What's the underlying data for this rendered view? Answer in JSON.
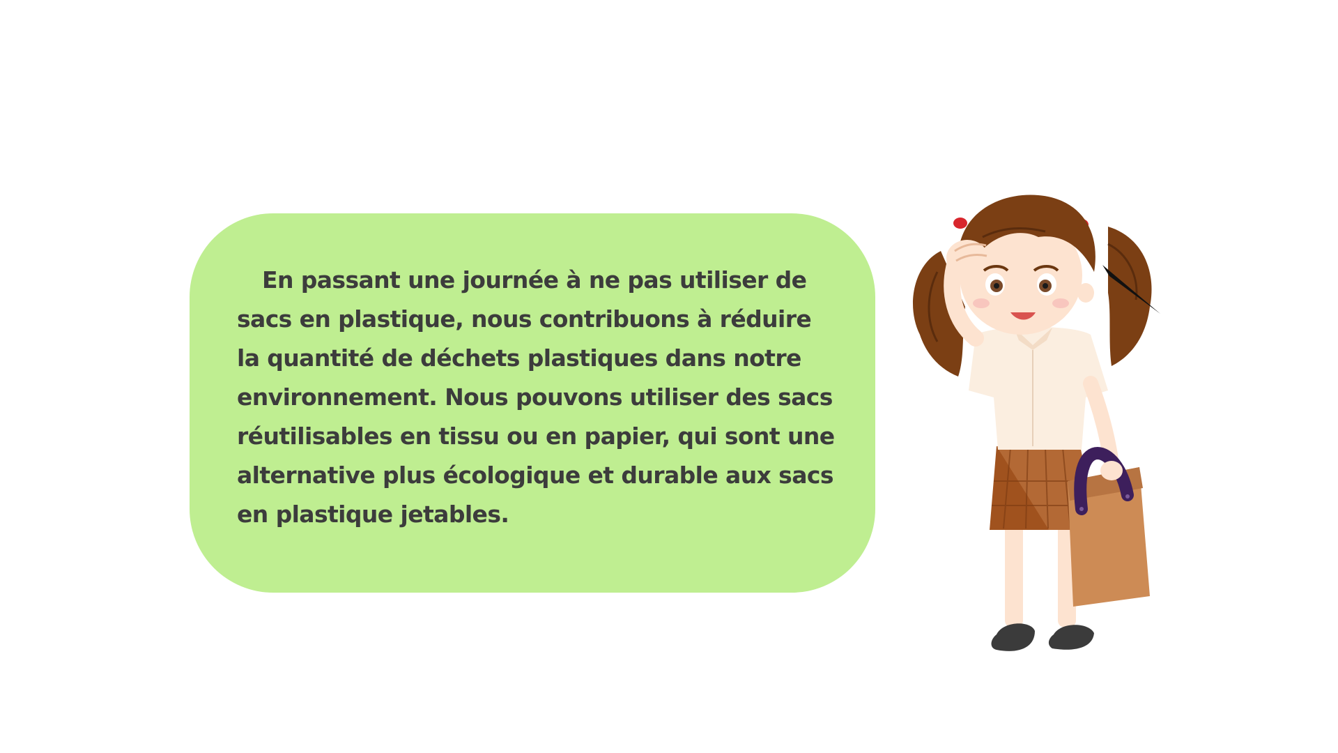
{
  "message": {
    "text": "En passant une journée à ne pas utiliser de sacs en plastique, nous contribuons à réduire la quantité de déchets plastiques dans notre environnement. Nous pouvons utiliser des sacs réutilisables en tissu ou en papier, qui sont une alternative plus écologique et durable aux sacs en plastique jetables."
  },
  "colors": {
    "background": "#ffffff",
    "bubble": "#bfee91",
    "text": "#3c3c3c",
    "hair": "#7b3f14",
    "shirt": "#fbeee0",
    "skirt": "#a0521e",
    "bag": "#cd8b55",
    "bag_handle": "#3d1f5c",
    "shoes": "#3b3b3b"
  },
  "illustration": {
    "subject": "girl-with-shopping-bag"
  }
}
